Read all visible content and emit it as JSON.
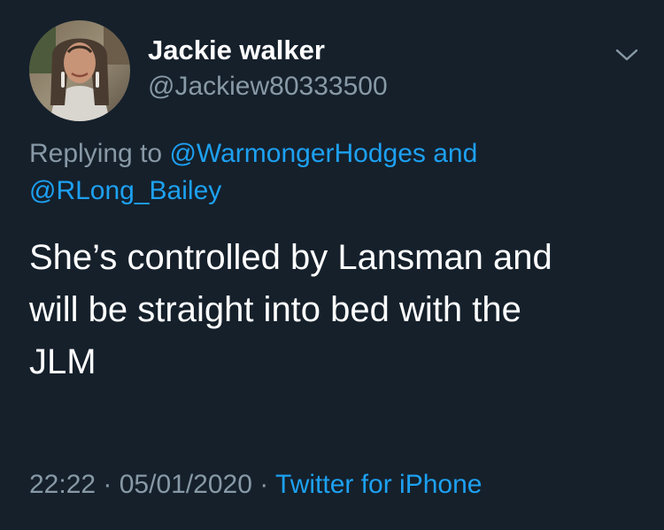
{
  "colors": {
    "background": "#15202b",
    "primary_text": "#ffffff",
    "secondary_text": "#8899a6",
    "link": "#1da1f2"
  },
  "author": {
    "display_name": "Jackie walker",
    "handle": "@Jackiew80333500",
    "avatar_icon": "profile-photo"
  },
  "menu": {
    "icon": "chevron-down-icon"
  },
  "reply": {
    "prefix": "Replying to ",
    "mentions": [
      "@WarmongerHodges",
      "@RLong_Bailey"
    ],
    "conjunction": " and "
  },
  "tweet": {
    "lines": [
      "She’s controlled by Lansman and",
      "will be straight into bed with the",
      "JLM"
    ]
  },
  "meta": {
    "time": "22:22",
    "separator": " · ",
    "date": "05/01/2020",
    "source": "Twitter for iPhone"
  }
}
